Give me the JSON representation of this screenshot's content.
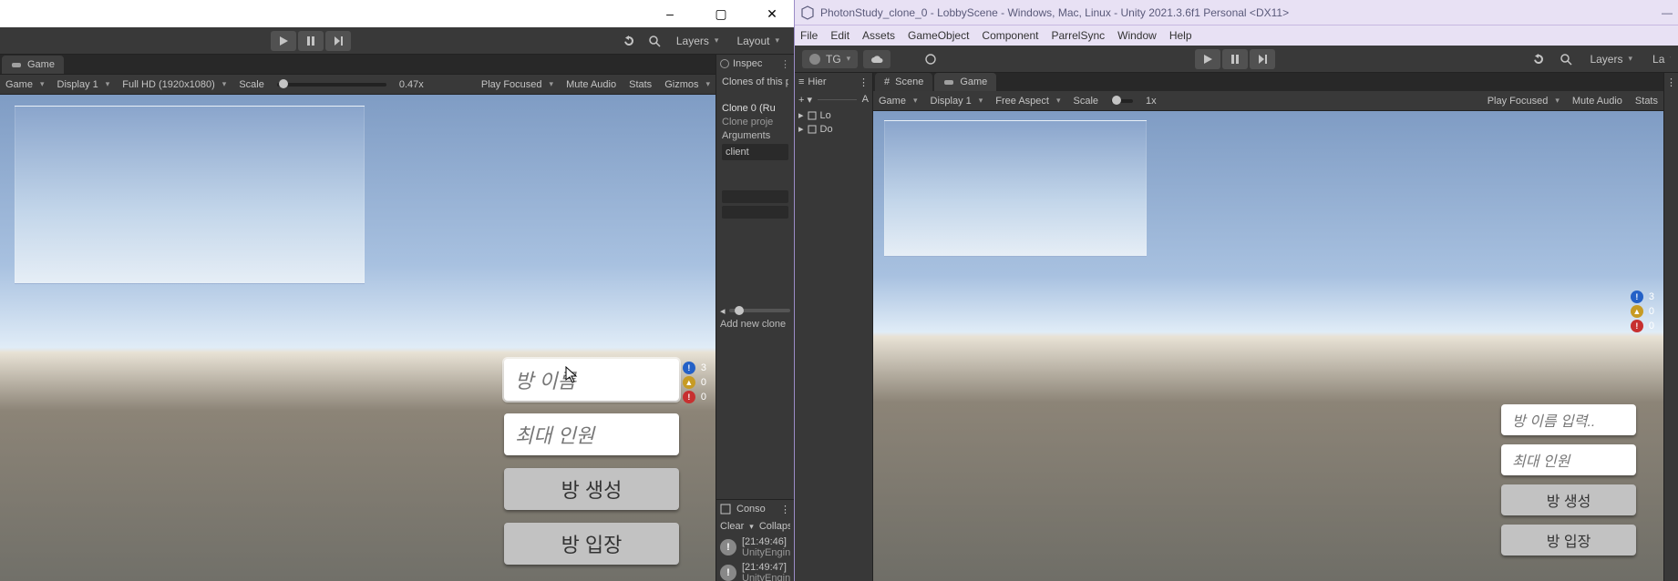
{
  "left": {
    "window_controls": {
      "min": "–",
      "max": "▢",
      "close": "✕"
    },
    "play_toolbar": {
      "history_icon": "history-icon",
      "search_icon": "search-icon",
      "layers_label": "Layers",
      "layout_label": "Layout"
    },
    "game_tab": {
      "label": "Game"
    },
    "game_toolbar": {
      "game_drop": "Game",
      "display_drop": "Display 1",
      "resolution_drop": "Full HD (1920x1080)",
      "scale_label": "Scale",
      "scale_value": "0.47x",
      "play_focused": "Play Focused",
      "mute_audio": "Mute Audio",
      "stats": "Stats",
      "gizmos": "Gizmos"
    },
    "lobby": {
      "room_name_placeholder": "방 이름",
      "max_players_placeholder": "최대 인원",
      "create_room": "방 생성",
      "join_room": "방 입장"
    },
    "status": {
      "info": "3",
      "warn": "0",
      "err": "0"
    },
    "inspector_tab": "Inspec",
    "clones": {
      "title": "Clones of this project",
      "item_title": "Clone 0 (Ru",
      "sub1": "Clone proje",
      "args_label": "Arguments",
      "args_value": "client",
      "add_btn": "Add new clone"
    },
    "console": {
      "tab": "Conso",
      "clear": "Clear",
      "collapse": "Collaps",
      "rows": [
        {
          "time": "[21:49:46]",
          "src": "UnityEngin"
        },
        {
          "time": "[21:49:47]",
          "src": "UnityEngin"
        }
      ]
    }
  },
  "right": {
    "title": "PhotonStudy_clone_0 - LobbyScene - Windows, Mac, Linux - Unity 2021.3.6f1 Personal <DX11>",
    "menubar": [
      "File",
      "Edit",
      "Assets",
      "GameObject",
      "Component",
      "ParrelSync",
      "Window",
      "Help"
    ],
    "account": {
      "tg": "TG"
    },
    "play_toolbar": {
      "layers_label": "Layers",
      "layout_label": "La"
    },
    "hier_tab": "Hier",
    "hier_rows": [
      "Lo",
      "Do"
    ],
    "scene_tab": "Scene",
    "game_tab": "Game",
    "game_toolbar": {
      "game_drop": "Game",
      "display_drop": "Display 1",
      "resolution_drop": "Free Aspect",
      "scale_label": "Scale",
      "scale_value": "1x",
      "play_focused": "Play Focused",
      "mute_audio": "Mute Audio",
      "stats": "Stats"
    },
    "lobby": {
      "room_name_placeholder": "방 이름 입력..",
      "max_players_placeholder": "최대 인원",
      "create_room": "방 생성",
      "join_room": "방 입장"
    },
    "status": {
      "info": "3",
      "warn": "0",
      "err": "0"
    }
  }
}
